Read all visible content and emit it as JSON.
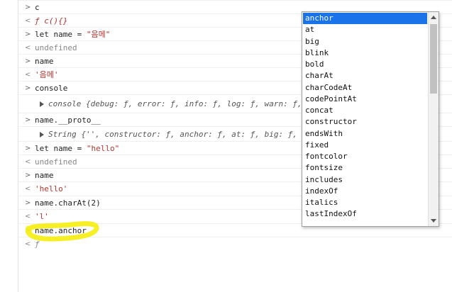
{
  "console": {
    "rows": [
      {
        "prompt": ">",
        "text": "c"
      },
      {
        "prompt": "<",
        "text": "ƒ c(){}"
      },
      {
        "prompt": ">",
        "text_pre": "let name = ",
        "text_str": "\"음메\""
      },
      {
        "prompt": "<",
        "text": "undefined"
      },
      {
        "prompt": ">",
        "text": "name"
      },
      {
        "prompt": "<",
        "text": "'음메'"
      },
      {
        "prompt": ">",
        "text": "console"
      },
      {
        "prompt": "",
        "text": "console {debug: ƒ, error: ƒ, info: ƒ, log: ƒ, warn: ƒ, "
      },
      {
        "prompt": ">",
        "text": "name.__proto__"
      },
      {
        "prompt": "",
        "text": "String {'', constructor: ƒ, anchor: ƒ, at: ƒ, big: ƒ, "
      },
      {
        "prompt": ">",
        "text_pre": "let name = ",
        "text_str": "\"hello\""
      },
      {
        "prompt": "<",
        "text": "undefined"
      },
      {
        "prompt": ">",
        "text": "name"
      },
      {
        "prompt": "<",
        "text": "'hello'"
      },
      {
        "prompt": ">",
        "text": "name.charAt(2)"
      },
      {
        "prompt": "<",
        "text": "'l'"
      },
      {
        "prompt": ">",
        "text": "name.anchor"
      },
      {
        "prompt": "<",
        "text": "ƒ"
      }
    ]
  },
  "autocomplete": {
    "items": [
      "anchor",
      "at",
      "big",
      "blink",
      "bold",
      "charAt",
      "charCodeAt",
      "codePointAt",
      "concat",
      "constructor",
      "endsWith",
      "fixed",
      "fontcolor",
      "fontsize",
      "includes",
      "indexOf",
      "italics",
      "lastIndexOf"
    ],
    "selected_index": 0
  },
  "colors": {
    "selection": "#1a73e8",
    "string": "#b0362f",
    "highlighter": "#f7ee1a"
  }
}
